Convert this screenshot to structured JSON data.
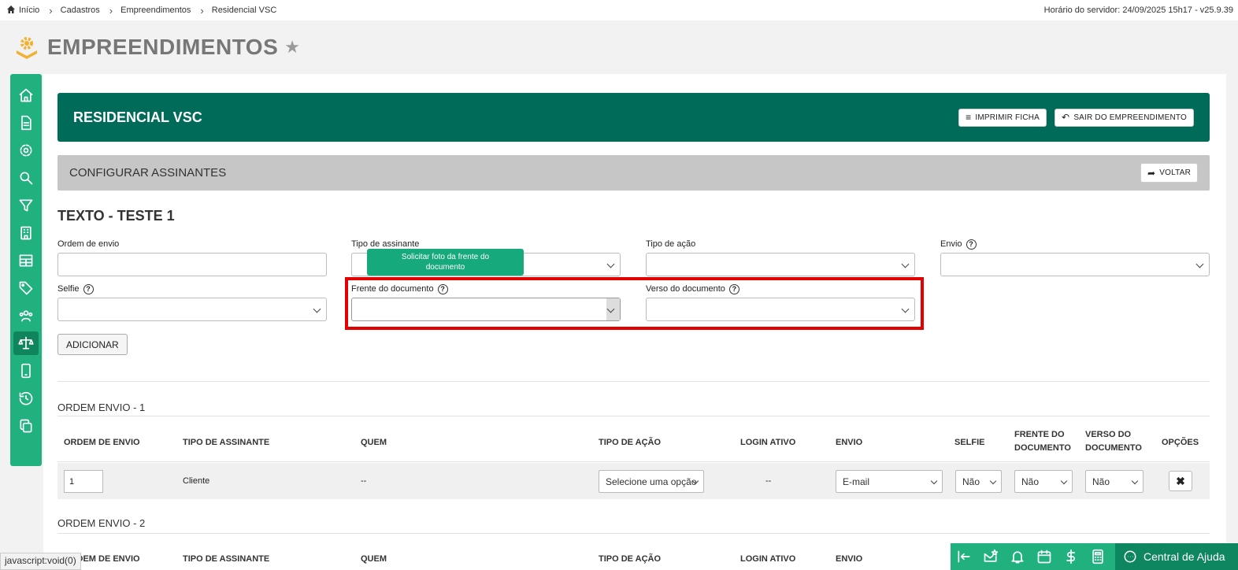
{
  "breadcrumb": {
    "items": [
      "Início",
      "Cadastros",
      "Empreendimentos",
      "Residencial VSC"
    ]
  },
  "server_time": "Horário do servidor: 24/09/2025 15h17 - v25.9.39",
  "page": {
    "title": "EMPREENDIMENTOS"
  },
  "sidebar": {
    "items": [
      "home-icon",
      "document-icon",
      "settings-icon",
      "search-icon",
      "filter-icon",
      "building-icon",
      "table-icon",
      "tag-icon",
      "users-icon",
      "scale-icon",
      "phone-icon",
      "history-icon",
      "copy-icon"
    ],
    "active_index": 9
  },
  "banner": {
    "title": "RESIDENCIAL VSC",
    "print_label": "IMPRIMIR FICHA",
    "exit_label": "SAIR DO EMPREENDIMENTO"
  },
  "subbar": {
    "title": "CONFIGURAR ASSINANTES",
    "back_label": "VOLTAR"
  },
  "form": {
    "title": "TEXTO - TESTE 1",
    "labels": {
      "ordem": "Ordem de envio",
      "tipo_assinante": "Tipo de assinante",
      "tipo_acao": "Tipo de ação",
      "envio": "Envio",
      "selfie": "Selfie",
      "frente": "Frente do documento",
      "verso": "Verso do documento"
    },
    "tooltip": "Solicitar foto da frente do documento",
    "add_label": "ADICIONAR"
  },
  "orders": [
    {
      "label": "ORDEM ENVIO - 1",
      "headers": [
        "ORDEM DE ENVIO",
        "TIPO DE ASSINANTE",
        "QUEM",
        "TIPO DE AÇÃO",
        "LOGIN ATIVO",
        "ENVIO",
        "SELFIE",
        "FRENTE DO DOCUMENTO",
        "VERSO DO DOCUMENTO",
        "OPÇÕES"
      ],
      "row": {
        "ordem": "1",
        "tipo_assinante": "Cliente",
        "quem": "--",
        "tipo_acao": "Selecione uma opção",
        "login_ativo": "--",
        "envio": "E-mail",
        "selfie": "Não",
        "frente": "Não",
        "verso": "Não",
        "delete": "✖"
      }
    },
    {
      "label": "ORDEM ENVIO - 2",
      "headers": [
        "ORDEM DE ENVIO",
        "TIPO DE ASSINANTE",
        "QUEM",
        "TIPO DE AÇÃO",
        "LOGIN ATIVO",
        "ENVIO"
      ]
    }
  ],
  "status_text": "javascript:void(0)",
  "bottom_bar": {
    "icons": [
      "collapse-left-icon",
      "mail-star-icon",
      "bell-icon",
      "calendar-icon",
      "dollar-icon",
      "calculator-icon"
    ],
    "help_label": "Central de Ajuda"
  },
  "colors": {
    "accent": "#20b17f",
    "banner": "#016b5a",
    "highlight": "#e30000"
  }
}
